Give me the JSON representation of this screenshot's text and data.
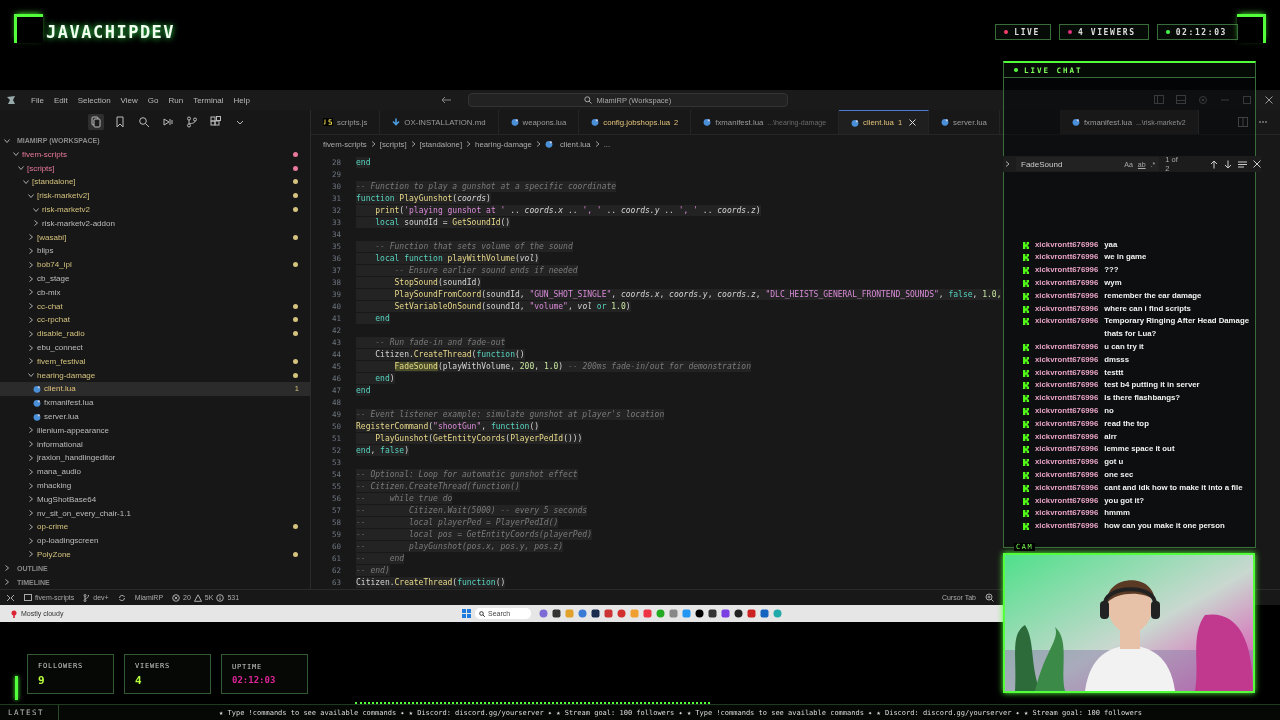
{
  "header": {
    "logo": "JAVACHIPDEV",
    "badges": [
      {
        "label": "LIVE",
        "color": "#ff3d6e"
      },
      {
        "label": "4  VIEWERS",
        "color": "#e0307a"
      },
      {
        "label": "02:12:03",
        "color": "#4cff4c"
      }
    ]
  },
  "vscode": {
    "menu": [
      "File",
      "Edit",
      "Selection",
      "View",
      "Go",
      "Run",
      "Terminal",
      "Help"
    ],
    "command_center": "MiamiRP (Workspace)",
    "explorer": {
      "workspace": {
        "label": "MIAMIRP (WORKSPACE)",
        "expanded": true
      },
      "tree": [
        {
          "kind": "folder",
          "label": "fivem-scripts",
          "expanded": true,
          "selected": false,
          "color": "#e8799a",
          "children": [
            {
              "kind": "folder",
              "label": "[scripts]",
              "expanded": true,
              "selected": false,
              "color": "#e8799a",
              "children": [
                {
                  "kind": "folder",
                  "label": "[standalone]",
                  "expanded": true,
                  "selected": false,
                  "color": "#d4c27e",
                  "children": [
                    {
                      "kind": "folder",
                      "label": "[risk-marketv2]",
                      "expanded": true,
                      "selected": false,
                      "color": "#d4c27e",
                      "children": [
                        {
                          "kind": "folder",
                          "label": "risk-marketv2",
                          "expanded": true,
                          "selected": false,
                          "color": "#d4c27e"
                        },
                        {
                          "kind": "folder",
                          "label": "risk-marketv2-addon",
                          "expanded": false,
                          "selected": false
                        }
                      ]
                    },
                    {
                      "kind": "folder",
                      "label": "[wasabi]",
                      "expanded": false,
                      "selected": false,
                      "color": "#d4c27e"
                    },
                    {
                      "kind": "folder",
                      "label": "blips",
                      "expanded": false,
                      "selected": false
                    },
                    {
                      "kind": "folder",
                      "label": "bob74_ipl",
                      "expanded": false,
                      "selected": false,
                      "color": "#d4c27e"
                    },
                    {
                      "kind": "folder",
                      "label": "cb_stage",
                      "expanded": false,
                      "selected": false
                    },
                    {
                      "kind": "folder",
                      "label": "cb-mix",
                      "expanded": false,
                      "selected": false
                    },
                    {
                      "kind": "folder",
                      "label": "cc-chat",
                      "expanded": false,
                      "selected": false,
                      "color": "#d4c27e"
                    },
                    {
                      "kind": "folder",
                      "label": "cc-rpchat",
                      "expanded": false,
                      "selected": false,
                      "color": "#d4c27e"
                    },
                    {
                      "kind": "folder",
                      "label": "disable_radio",
                      "expanded": false,
                      "selected": false,
                      "color": "#d4c27e"
                    },
                    {
                      "kind": "folder",
                      "label": "ebu_connect",
                      "expanded": false,
                      "selected": false
                    },
                    {
                      "kind": "folder",
                      "label": "fivem_festival",
                      "expanded": false,
                      "selected": false,
                      "color": "#d4c27e"
                    },
                    {
                      "kind": "folder",
                      "label": "hearing-damage",
                      "expanded": true,
                      "selected": false,
                      "color": "#d4c27e",
                      "children": [
                        {
                          "kind": "file",
                          "label": "client.lua",
                          "selected": true,
                          "badge": "1"
                        },
                        {
                          "kind": "file",
                          "label": "fxmanifest.lua",
                          "selected": false
                        },
                        {
                          "kind": "file",
                          "label": "server.lua",
                          "selected": false
                        }
                      ]
                    },
                    {
                      "kind": "folder",
                      "label": "illenium-appearance",
                      "expanded": false,
                      "selected": false
                    },
                    {
                      "kind": "folder",
                      "label": "informational",
                      "expanded": false,
                      "selected": false
                    },
                    {
                      "kind": "folder",
                      "label": "jraxion_handlingeditor",
                      "expanded": false,
                      "selected": false
                    },
                    {
                      "kind": "folder",
                      "label": "mana_audio",
                      "expanded": false,
                      "selected": false
                    },
                    {
                      "kind": "folder",
                      "label": "mhacking",
                      "expanded": false,
                      "selected": false
                    },
                    {
                      "kind": "folder",
                      "label": "MugShotBase64",
                      "expanded": false,
                      "selected": false
                    },
                    {
                      "kind": "folder",
                      "label": "nv_sit_on_every_chair-1.1",
                      "expanded": false,
                      "selected": false
                    },
                    {
                      "kind": "folder",
                      "label": "op-crime",
                      "expanded": false,
                      "selected": false,
                      "color": "#d4c27e"
                    },
                    {
                      "kind": "folder",
                      "label": "op-loadingscreen",
                      "expanded": false,
                      "selected": false
                    },
                    {
                      "kind": "folder",
                      "label": "PolyZone",
                      "expanded": false,
                      "selected": false,
                      "color": "#d4c27e"
                    }
                  ]
                }
              ]
            }
          ]
        }
      ],
      "sections": [
        {
          "label": "OUTLINE",
          "expanded": false
        },
        {
          "label": "TIMELINE",
          "expanded": false
        }
      ]
    },
    "tabs": [
      {
        "kind": "js",
        "label": "scripts.js",
        "selected": false
      },
      {
        "kind": "md",
        "label": "OX-INSTALLATION.md",
        "selected": false
      },
      {
        "kind": "lua",
        "label": "weapons.lua",
        "selected": false
      },
      {
        "kind": "lua",
        "label": "config.jobshops.lua",
        "badge": "2",
        "selected": false
      },
      {
        "kind": "lua",
        "label": "fxmanifest.lua",
        "description": "...\\hearing-damage",
        "selected": false
      },
      {
        "kind": "lua",
        "label": "client.lua",
        "badge": "1",
        "selected": true
      },
      {
        "kind": "lua",
        "label": "server.lua",
        "selected": false
      },
      {
        "kind": "lua",
        "label": "fxmanifest.lua",
        "description": "...\\risk-marketv2",
        "selected": false
      }
    ],
    "breadcrumb": [
      "fivem-scripts",
      "[scripts]",
      "[standalone]",
      "hearing-damage",
      "client.lua",
      "..."
    ],
    "find": {
      "value": "FadeSound",
      "options": [
        "Aa",
        "ab",
        ".*"
      ],
      "result": "1 of 2"
    },
    "code": [
      {
        "n": "28",
        "t": [
          {
            "kind": "kw",
            "text": "end"
          }
        ]
      },
      {
        "n": "29"
      },
      {
        "n": "30",
        "t": [
          {
            "kind": "cmt",
            "text": "-- Function to play a gunshot at a specific coordinate"
          }
        ]
      },
      {
        "n": "31",
        "t": [
          {
            "kind": "kw",
            "text": "function "
          },
          {
            "kind": "fn",
            "text": "PlayGunshot"
          },
          {
            "kind": "p",
            "text": "("
          },
          {
            "kind": "par",
            "text": "coords"
          },
          {
            "kind": "p",
            "text": ")"
          }
        ]
      },
      {
        "n": "32",
        "t": [
          {
            "kind": "fn",
            "text": "    print"
          },
          {
            "kind": "p",
            "text": "("
          },
          {
            "kind": "str",
            "text": "'playing gunshot at '"
          },
          {
            "kind": "p",
            "text": " .. "
          },
          {
            "kind": "par",
            "text": "coords.x"
          },
          {
            "kind": "p",
            "text": " .. "
          },
          {
            "kind": "str",
            "text": "', '"
          },
          {
            "kind": "p",
            "text": " .. "
          },
          {
            "kind": "par",
            "text": "coords.y"
          },
          {
            "kind": "p",
            "text": " .. "
          },
          {
            "kind": "str",
            "text": "', '"
          },
          {
            "kind": "p",
            "text": " .. "
          },
          {
            "kind": "par",
            "text": "coords.z"
          },
          {
            "kind": "p",
            "text": ")"
          }
        ]
      },
      {
        "n": "33",
        "t": [
          {
            "kind": "kw",
            "text": "    local "
          },
          {
            "kind": "p",
            "text": "soundId = "
          },
          {
            "kind": "fn",
            "text": "GetSoundId"
          },
          {
            "kind": "p",
            "text": "()"
          }
        ]
      },
      {
        "n": "34"
      },
      {
        "n": "35",
        "t": [
          {
            "kind": "cmt",
            "text": "    -- Function that sets volume of the sound"
          }
        ]
      },
      {
        "n": "36",
        "t": [
          {
            "kind": "kw",
            "text": "    local function "
          },
          {
            "kind": "fn",
            "text": "playWithVolume"
          },
          {
            "kind": "p",
            "text": "("
          },
          {
            "kind": "par",
            "text": "vol"
          },
          {
            "kind": "p",
            "text": ")"
          }
        ]
      },
      {
        "n": "37",
        "t": [
          {
            "kind": "cmt",
            "text": "        -- Ensure earlier sound ends if needed"
          }
        ]
      },
      {
        "n": "38",
        "t": [
          {
            "kind": "fn",
            "text": "        StopSound"
          },
          {
            "kind": "p",
            "text": "(soundId)"
          }
        ]
      },
      {
        "n": "39",
        "t": [
          {
            "kind": "fn",
            "text": "        PlaySoundFromCoord"
          },
          {
            "kind": "p",
            "text": "(soundId, "
          },
          {
            "kind": "str",
            "text": "\"GUN_SHOT_SINGLE\""
          },
          {
            "kind": "p",
            "text": ", "
          },
          {
            "kind": "par",
            "text": "coords.x"
          },
          {
            "kind": "p",
            "text": ", "
          },
          {
            "kind": "par",
            "text": "coords.y"
          },
          {
            "kind": "p",
            "text": ", "
          },
          {
            "kind": "par",
            "text": "coords.z"
          },
          {
            "kind": "p",
            "text": ", "
          },
          {
            "kind": "str",
            "text": "\"DLC_HEISTS_GENERAL_FRONTEND_SOUNDS\""
          },
          {
            "kind": "p",
            "text": ", "
          },
          {
            "kind": "kw",
            "text": "false"
          },
          {
            "kind": "p",
            "text": ", "
          },
          {
            "kind": "num",
            "text": "1.0,"
          }
        ]
      },
      {
        "n": "40",
        "t": [
          {
            "kind": "fn",
            "text": "        SetVariableOnSound"
          },
          {
            "kind": "p",
            "text": "(soundId, "
          },
          {
            "kind": "str",
            "text": "\"volume\""
          },
          {
            "kind": "p",
            "text": ", "
          },
          {
            "kind": "par",
            "text": "vol"
          },
          {
            "kind": "kw",
            "text": " or "
          },
          {
            "kind": "num",
            "text": "1.0"
          },
          {
            "kind": "p",
            "text": ")"
          }
        ]
      },
      {
        "n": "41",
        "t": [
          {
            "kind": "kw",
            "text": "    end"
          }
        ]
      },
      {
        "n": "42"
      },
      {
        "n": "43",
        "t": [
          {
            "kind": "cmt",
            "text": "    -- Run fade-in and fade-out"
          }
        ]
      },
      {
        "n": "44",
        "t": [
          {
            "kind": "p",
            "text": "    Citizen."
          },
          {
            "kind": "fn",
            "text": "CreateThread"
          },
          {
            "kind": "p",
            "text": "("
          },
          {
            "kind": "kw",
            "text": "function"
          },
          {
            "kind": "p",
            "text": "()"
          }
        ]
      },
      {
        "n": "45",
        "t": [
          {
            "kind": "match",
            "text": "        FadeSound"
          },
          {
            "kind": "p",
            "text": "(playWithVolume, "
          },
          {
            "kind": "num",
            "text": "200"
          },
          {
            "kind": "p",
            "text": ", "
          },
          {
            "kind": "num",
            "text": "1.0"
          },
          {
            "kind": "p",
            "text": ") "
          },
          {
            "kind": "cmt",
            "text": "-- 200ms fade-in/out for demonstration"
          }
        ]
      },
      {
        "n": "46",
        "t": [
          {
            "kind": "kw",
            "text": "    end"
          },
          {
            "kind": "p",
            "text": ")"
          }
        ]
      },
      {
        "n": "47",
        "t": [
          {
            "kind": "kw",
            "text": "end"
          }
        ]
      },
      {
        "n": "48"
      },
      {
        "n": "49",
        "t": [
          {
            "kind": "cmt",
            "text": "-- Event listener example: simulate gunshot at player's location"
          }
        ]
      },
      {
        "n": "50",
        "t": [
          {
            "kind": "fn",
            "text": "RegisterCommand"
          },
          {
            "kind": "p",
            "text": "("
          },
          {
            "kind": "str",
            "text": "\"shootGun\""
          },
          {
            "kind": "p",
            "text": ", "
          },
          {
            "kind": "kw",
            "text": "function"
          },
          {
            "kind": "p",
            "text": "()"
          }
        ]
      },
      {
        "n": "51",
        "t": [
          {
            "kind": "fn",
            "text": "    PlayGunshot"
          },
          {
            "kind": "p",
            "text": "("
          },
          {
            "kind": "fn",
            "text": "GetEntityCoords"
          },
          {
            "kind": "p",
            "text": "("
          },
          {
            "kind": "fn",
            "text": "PlayerPedId"
          },
          {
            "kind": "p",
            "text": "()))"
          }
        ]
      },
      {
        "n": "52",
        "t": [
          {
            "kind": "kw",
            "text": "end"
          },
          {
            "kind": "p",
            "text": ", "
          },
          {
            "kind": "kw",
            "text": "false"
          },
          {
            "kind": "p",
            "text": ")"
          }
        ]
      },
      {
        "n": "53"
      },
      {
        "n": "54",
        "t": [
          {
            "kind": "cmt",
            "text": "-- Optional: Loop for automatic gunshot effect"
          }
        ]
      },
      {
        "n": "55",
        "t": [
          {
            "kind": "cmt",
            "text": "-- Citizen.CreateThread(function()"
          }
        ]
      },
      {
        "n": "56",
        "t": [
          {
            "kind": "cmt",
            "text": "--     while true do"
          }
        ]
      },
      {
        "n": "57",
        "t": [
          {
            "kind": "cmt",
            "text": "--         Citizen.Wait(5000) -- every 5 seconds"
          }
        ]
      },
      {
        "n": "58",
        "t": [
          {
            "kind": "cmt",
            "text": "--         local playerPed = PlayerPedId()"
          }
        ]
      },
      {
        "n": "59",
        "t": [
          {
            "kind": "cmt",
            "text": "--         local pos = GetEntityCoords(playerPed)"
          }
        ]
      },
      {
        "n": "60",
        "t": [
          {
            "kind": "cmt",
            "text": "--         playGunshot(pos.x, pos.y, pos.z)"
          }
        ]
      },
      {
        "n": "61",
        "t": [
          {
            "kind": "cmt",
            "text": "--     end"
          }
        ]
      },
      {
        "n": "62",
        "t": [
          {
            "kind": "cmt",
            "text": "-- end)"
          }
        ]
      },
      {
        "n": "63",
        "t": [
          {
            "kind": "p",
            "text": "Citizen."
          },
          {
            "kind": "fn",
            "text": "CreateThread"
          },
          {
            "kind": "p",
            "text": "("
          },
          {
            "kind": "kw",
            "text": "function"
          },
          {
            "kind": "p",
            "text": "()"
          }
        ]
      }
    ],
    "status_bar": {
      "folder": "fivem-scripts",
      "branch": "dev+",
      "workspace": "MiamiRP",
      "errors": "20",
      "warnings": "5K",
      "infos": "531",
      "right": "Cursor Tab"
    }
  },
  "taskbar": {
    "weather": "Mostly cloudy",
    "search": "Search"
  },
  "chat": {
    "title": "LIVE CHAT",
    "messages": [
      {
        "user": "xickvrontt676996",
        "text": "yaa"
      },
      {
        "user": "xickvrontt676996",
        "text": "we in game"
      },
      {
        "user": "xickvrontt676996",
        "text": "???"
      },
      {
        "user": "xickvrontt676996",
        "text": "wym"
      },
      {
        "user": "xickvrontt676996",
        "text": "remember the ear damage"
      },
      {
        "user": "xickvrontt676996",
        "text": "where can i find scripts"
      },
      {
        "user": "xickvrontt676996",
        "text": "Temporary Ringing After Head Damage thats for Lua?"
      },
      {
        "user": "xickvrontt676996",
        "text": "u can try it"
      },
      {
        "user": "xickvrontt676996",
        "text": "dmsss"
      },
      {
        "user": "xickvrontt676996",
        "text": "testtt"
      },
      {
        "user": "xickvrontt676996",
        "text": "test b4 putting it in server"
      },
      {
        "user": "xickvrontt676996",
        "text": "Is there flashbangs?"
      },
      {
        "user": "xickvrontt676996",
        "text": "no"
      },
      {
        "user": "xickvrontt676996",
        "text": "read the top"
      },
      {
        "user": "xickvrontt676996",
        "text": "alrr"
      },
      {
        "user": "xickvrontt676996",
        "text": "lemme space it out"
      },
      {
        "user": "xickvrontt676996",
        "text": "got u"
      },
      {
        "user": "xickvrontt676996",
        "text": "one sec"
      },
      {
        "user": "xickvrontt676996",
        "text": "cant and idk how to make it into a file"
      },
      {
        "user": "xickvrontt676996",
        "text": "you got it?"
      },
      {
        "user": "xickvrontt676996",
        "text": "hmmm"
      },
      {
        "user": "xickvrontt676996",
        "text": "how can you make it one person"
      }
    ]
  },
  "cam": {
    "label": "CAM"
  },
  "stats": [
    {
      "label": "FOLLOWERS",
      "value": "9",
      "color": "#b8ff3c"
    },
    {
      "label": "VIEWERS",
      "value": "4",
      "color": "#b8ff3c"
    },
    {
      "label": "UPTIME",
      "value": "02:12:03",
      "color": "#e0259a"
    }
  ],
  "ticker": {
    "label": "LATEST",
    "text": "★ Type !commands to see available commands ✦ ★ Discord: discord.gg/yourserver ✦ ★ Stream goal: 100 followers ✦ ★ Type !commands to see available commands ✦ ★ Discord: discord.gg/yourserver ✦ ★ Stream goal: 100 followers"
  }
}
